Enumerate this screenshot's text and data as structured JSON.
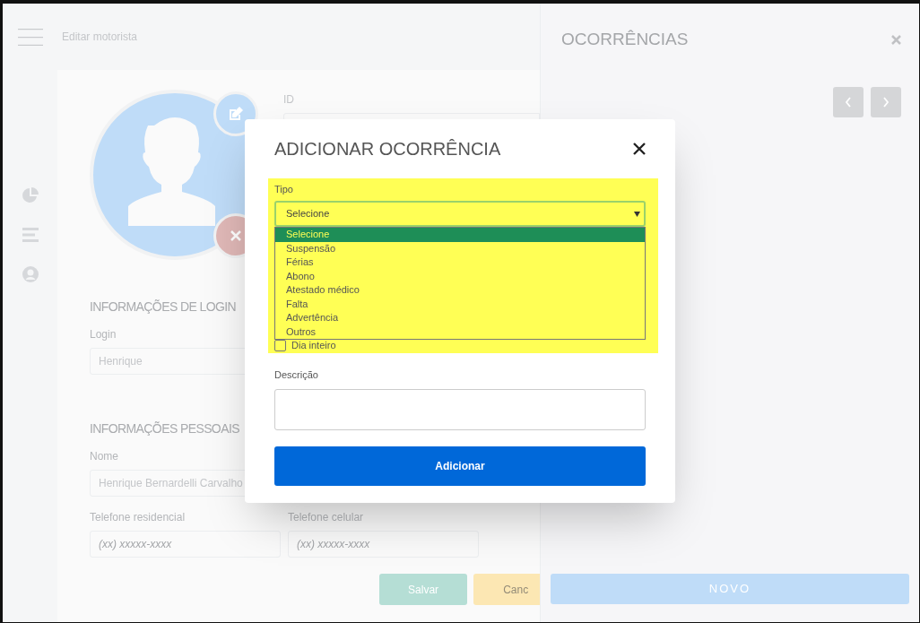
{
  "header": {
    "title": "Editar motorista"
  },
  "profile": {
    "id_label": "ID",
    "login_section": "INFORMAÇÕES DE LOGIN",
    "login_label": "Login",
    "login_value": "Henrique",
    "personal_section": "INFORMAÇÕES PESSOAIS",
    "name_label": "Nome",
    "name_value": "Henrique Bernardelli Carvalho",
    "phone_home_label": "Telefone residencial",
    "phone_home_placeholder": "(xx) xxxxx-xxxx",
    "phone_mobile_label": "Telefone celular",
    "phone_mobile_placeholder": "(xx) xxxxx-xxxx",
    "buttons": [
      "Salvar",
      "Canc"
    ]
  },
  "panel": {
    "title": "OCORRÊNCIAS",
    "new_button": "NOVO"
  },
  "dialog": {
    "title": "ADICIONAR OCORRÊNCIA",
    "type_label": "Tipo",
    "select_value": "Selecione",
    "options": [
      {
        "label": "Selecione",
        "selected": true
      },
      {
        "label": "Suspensão",
        "selected": false
      },
      {
        "label": "Férias",
        "selected": false
      },
      {
        "label": "Abono",
        "selected": false
      },
      {
        "label": "Atestado médico",
        "selected": false
      },
      {
        "label": "Falta",
        "selected": false
      },
      {
        "label": "Advertência",
        "selected": false
      },
      {
        "label": "Outros",
        "selected": false
      }
    ],
    "all_day": {
      "label": "Dia inteiro",
      "checked": false
    },
    "description_label": "Descrição",
    "submit": "Adicionar"
  }
}
